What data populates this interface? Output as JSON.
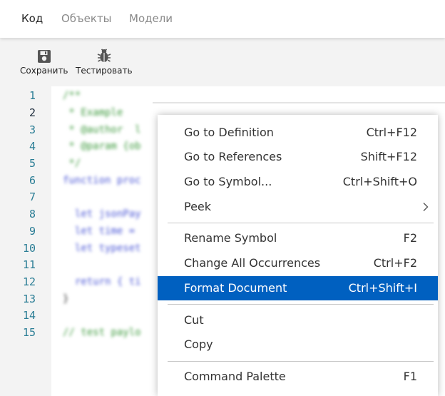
{
  "tabs": [
    {
      "label": "Код",
      "active": true
    },
    {
      "label": "Объекты",
      "active": false
    },
    {
      "label": "Модели",
      "active": false
    }
  ],
  "toolbar": {
    "save_label": "Сохранить",
    "save_icon": "save-icon",
    "test_label": "Тестировать",
    "test_icon": "bug-icon"
  },
  "editor": {
    "line_numbers": [
      "1",
      "2",
      "3",
      "4",
      "5",
      "6",
      "7",
      "8",
      "9",
      "10",
      "11",
      "12",
      "13",
      "14",
      "15"
    ],
    "active_line": "2",
    "code_lines": [
      "/**",
      " * Example",
      " * @author  l",
      " * @param {ob",
      " */",
      "function proc",
      "",
      "  let jsonPay",
      "  let time = ",
      "  let typeset",
      "",
      "  return { ti",
      "}",
      "",
      "// test paylo"
    ]
  },
  "context_menu": {
    "items": [
      {
        "label": "Go to Definition",
        "shortcut": "Ctrl+F12"
      },
      {
        "label": "Go to References",
        "shortcut": "Shift+F12"
      },
      {
        "label": "Go to Symbol...",
        "shortcut": "Ctrl+Shift+O"
      },
      {
        "label": "Peek",
        "shortcut": "",
        "submenu": true
      },
      {
        "label": "Rename Symbol",
        "shortcut": "F2"
      },
      {
        "label": "Change All Occurrences",
        "shortcut": "Ctrl+F2"
      },
      {
        "label": "Format Document",
        "shortcut": "Ctrl+Shift+I",
        "highlighted": true
      },
      {
        "label": "Cut",
        "shortcut": ""
      },
      {
        "label": "Copy",
        "shortcut": ""
      },
      {
        "label": "Command Palette",
        "shortcut": "F1"
      }
    ]
  },
  "colors": {
    "accent": "#0060c0",
    "line_number": "#2a7d95",
    "comment": "#3d9a3d",
    "keyword": "#4a56d6"
  }
}
